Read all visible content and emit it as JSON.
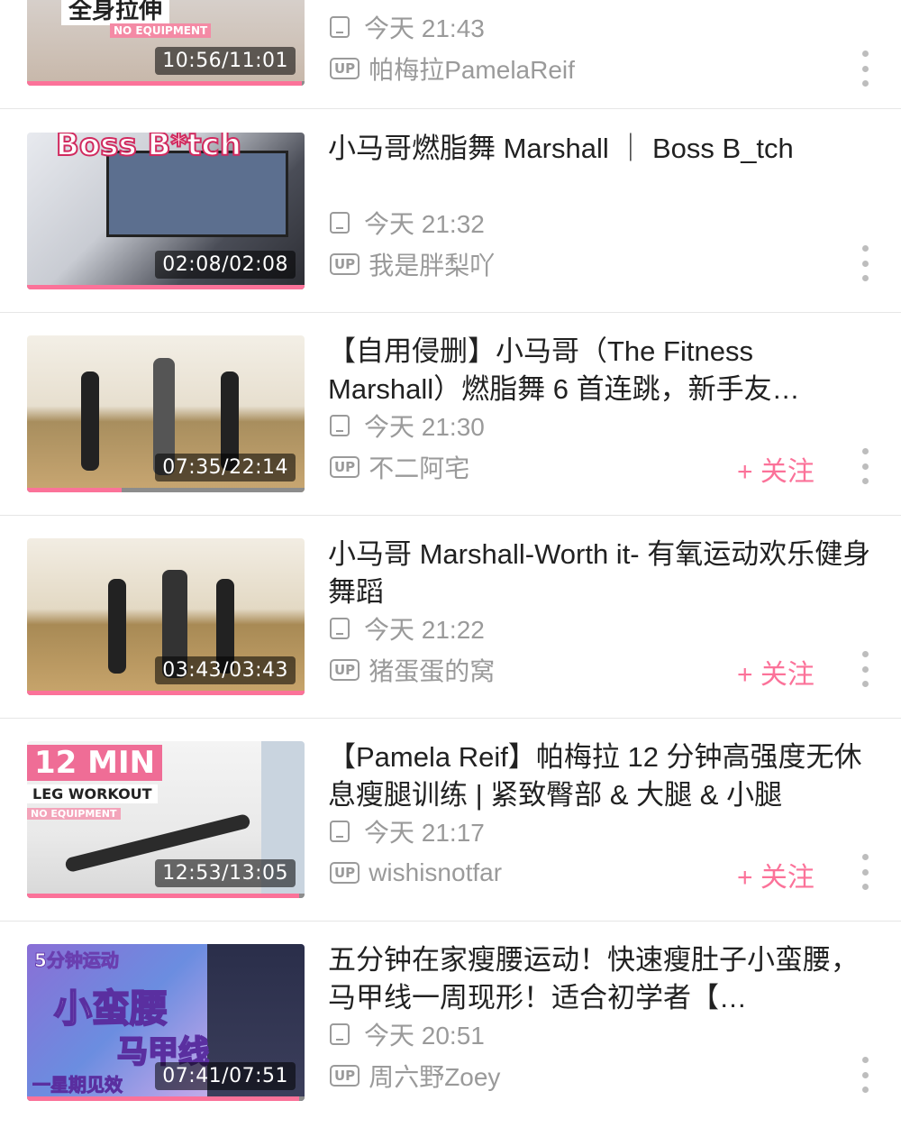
{
  "accent_color": "#fb7299",
  "items": [
    {
      "title": "",
      "time": "今天 21:43",
      "uploader": "帕梅拉PamelaReif",
      "duration": "10:56/11:01",
      "progress": 0.99,
      "show_follow": false,
      "thumb_text_1": "全身拉伸",
      "thumb_text_2": "NO EQUIPMENT"
    },
    {
      "title": "小马哥燃脂舞 Marshall ｜ Boss B_tch",
      "time": "今天 21:32",
      "uploader": "我是胖梨吖",
      "duration": "02:08/02:08",
      "progress": 1.0,
      "show_follow": false,
      "thumb_text_1": "Boss B*tch"
    },
    {
      "title": "【自用侵删】小马哥（The Fitness Marshall）燃脂舞 6 首连跳，新手友…",
      "time": "今天 21:30",
      "uploader": "不二阿宅",
      "duration": "07:35/22:14",
      "progress": 0.34,
      "show_follow": true
    },
    {
      "title": "小马哥 Marshall-Worth it- 有氧运动欢乐健身舞蹈",
      "time": "今天 21:22",
      "uploader": "猪蛋蛋的窝",
      "duration": "03:43/03:43",
      "progress": 1.0,
      "show_follow": true
    },
    {
      "title": "【Pamela Reif】帕梅拉 12 分钟高强度无休息瘦腿训练 | 紧致臀部 & 大腿 & 小腿",
      "time": "今天 21:17",
      "uploader": "wishisnotfar",
      "duration": "12:53/13:05",
      "progress": 0.98,
      "show_follow": true,
      "thumb_text_1": "12 MIN",
      "thumb_text_2": "LEG WORKOUT",
      "thumb_text_3": "NO EQUIPMENT"
    },
    {
      "title": "五分钟在家瘦腰运动！快速瘦肚子小蛮腰，马甲线一周现形！适合初学者【…",
      "time": "今天 20:51",
      "uploader": "周六野Zoey",
      "duration": "07:41/07:51",
      "progress": 0.98,
      "show_follow": false,
      "thumb_text_1": "5分钟运动",
      "thumb_text_2": "小蛮腰",
      "thumb_text_3": "马甲线",
      "thumb_text_4": "一星期见效"
    }
  ],
  "follow_label": "+ 关注",
  "up_label": "UP"
}
